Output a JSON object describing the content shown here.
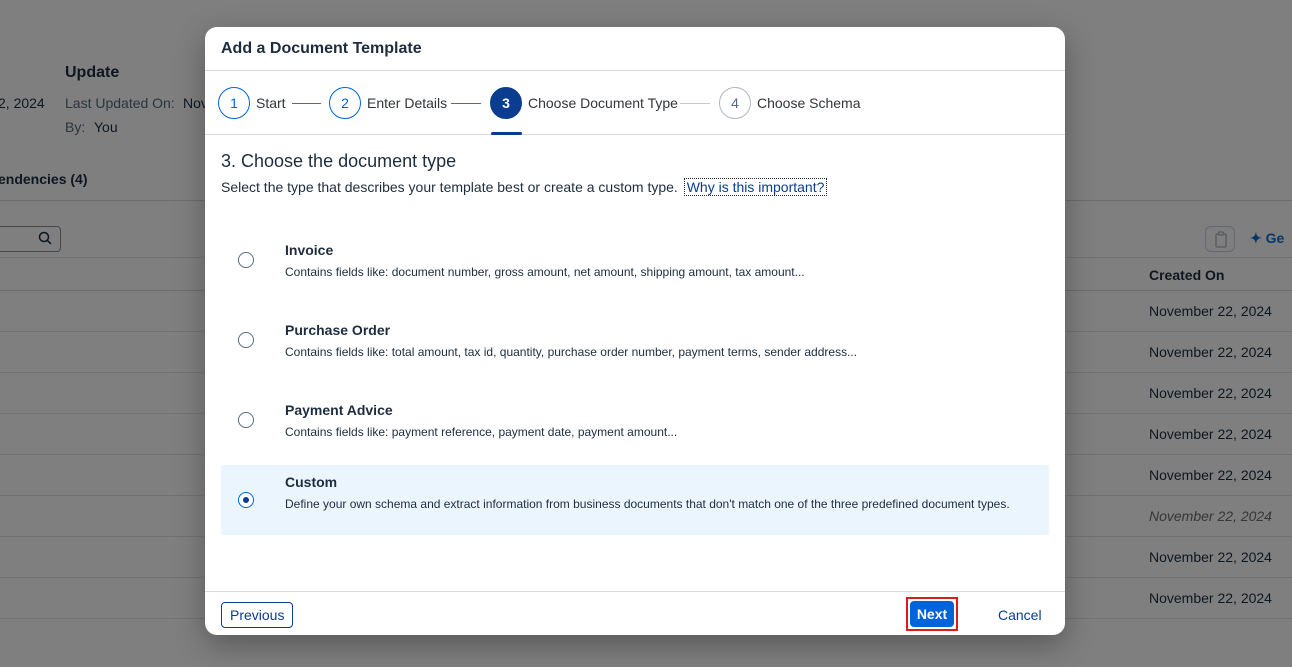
{
  "background": {
    "page_title": "Update",
    "date_fragment": "2, 2024",
    "last_updated_label": "Last Updated On:",
    "last_updated_value": "Nov",
    "by_label": "By:",
    "by_value": "You",
    "dependencies_tab": "endencies (4)",
    "generate_fragment": "Ge",
    "column_header": "Created On",
    "rows": [
      "November 22, 2024",
      "November 22, 2024",
      "November 22, 2024",
      "November 22, 2024",
      "November 22, 2024",
      "November 22, 2024",
      "November 22, 2024",
      "November 22, 2024"
    ]
  },
  "dialog": {
    "title": "Add a Document Template",
    "steps": [
      {
        "number": "1",
        "label": "Start",
        "state": "completed"
      },
      {
        "number": "2",
        "label": "Enter Details",
        "state": "completed"
      },
      {
        "number": "3",
        "label": "Choose Document Type",
        "state": "active"
      },
      {
        "number": "4",
        "label": "Choose Schema",
        "state": "inactive"
      }
    ],
    "heading": "3. Choose the document type",
    "description": "Select the type that describes your template best or create a custom type.",
    "help_link": "Why is this important?",
    "options": [
      {
        "title": "Invoice",
        "desc": "Contains fields like: document number, gross amount, net amount, shipping amount, tax amount...",
        "selected": false
      },
      {
        "title": "Purchase Order",
        "desc": "Contains fields like: total amount, tax id, quantity, purchase order number, payment terms, sender address...",
        "selected": false
      },
      {
        "title": "Payment Advice",
        "desc": "Contains fields like: payment reference, payment date, payment amount...",
        "selected": false
      },
      {
        "title": "Custom",
        "desc": "Define your own schema and extract information from business documents that don't match one of the three predefined document types.",
        "selected": true
      }
    ],
    "buttons": {
      "previous": "Previous",
      "next": "Next",
      "cancel": "Cancel"
    }
  },
  "colors": {
    "accent": "#0064d9",
    "active_step": "#0a3d8f",
    "highlight_border": "#e0191c",
    "selected_bg": "#ebf5fe"
  }
}
